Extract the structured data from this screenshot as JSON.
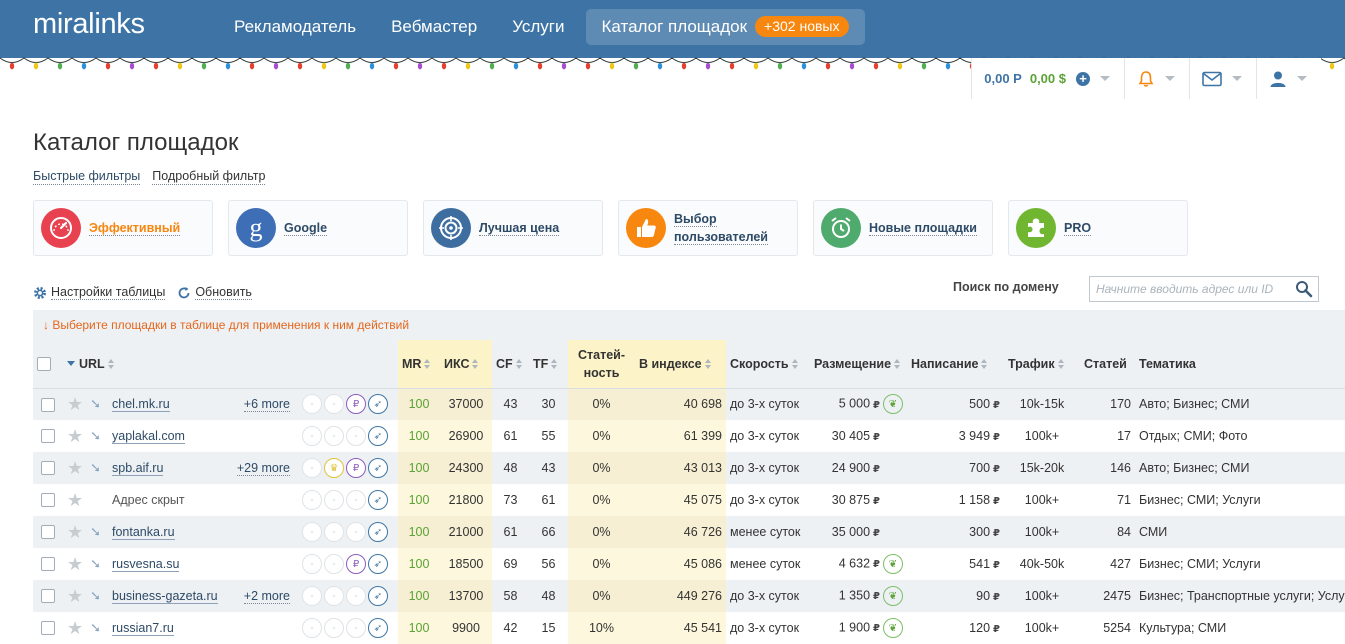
{
  "app": {
    "logo": "miralinks"
  },
  "nav": [
    {
      "label": "Рекламодатель"
    },
    {
      "label": "Вебмастер"
    },
    {
      "label": "Услуги"
    },
    {
      "label": "Каталог площадок",
      "badge": "+302 новых"
    }
  ],
  "userbar": {
    "balance_rub": "0,00 Р",
    "balance_usd": "0,00 $"
  },
  "page": {
    "title": "Каталог площадок"
  },
  "filter_tabs": [
    "Быстрые фильтры",
    "Подробный фильтр"
  ],
  "cards": [
    {
      "label": "Эффективный",
      "icon": "speedometer-icon",
      "color": "#e8414f"
    },
    {
      "label": "Google",
      "icon": "google-icon",
      "color": "#3e6eb5"
    },
    {
      "label": "Лучшая цена",
      "icon": "target-icon",
      "color": "#3e6ea0"
    },
    {
      "label1": "Выбор",
      "label2": "пользователей",
      "icon": "thumbs-up-icon",
      "color": "#f7870f"
    },
    {
      "label": "Новые площадки",
      "icon": "alarm-clock-icon",
      "color": "#4faa6e"
    },
    {
      "label": "PRO",
      "icon": "puzzle-icon",
      "color": "#70b630"
    }
  ],
  "tools": {
    "settings": "Настройки таблицы",
    "refresh": "Обновить"
  },
  "search": {
    "label": "Поиск по домену",
    "placeholder": "Начните вводить адрес или ID"
  },
  "notice": "↓ Выберите площадки в таблице для применения к ним действий",
  "columns": {
    "url": "URL",
    "mr": "MR",
    "iks": "ИКС",
    "cf": "CF",
    "tf": "TF",
    "articles_pct_1": "Статей-",
    "articles_pct_2": "ность",
    "indexed": "В индексе",
    "speed": "Скорость",
    "placement": "Размещение",
    "writing": "Написание",
    "traffic": "Трафик",
    "articles": "Статей",
    "topic": "Тематика"
  },
  "currency_sign": "₽",
  "rows": [
    {
      "url": "chel.mk.ru",
      "more": "+6 more",
      "mr": "100",
      "iks": "37000",
      "cf": "43",
      "tf": "30",
      "pct": "0%",
      "indexed": "40 698",
      "speed": "до 3-х суток",
      "placement": "5 000",
      "writing": "500",
      "traffic": "10k-15k",
      "articles": "170",
      "topic": "Авто; Бизнес; СМИ"
    },
    {
      "url": "yaplakal.com",
      "more": "",
      "mr": "100",
      "iks": "26900",
      "cf": "61",
      "tf": "55",
      "pct": "0%",
      "indexed": "61 399",
      "speed": "до 3-х суток",
      "placement": "30 405",
      "writing": "3 949",
      "traffic": "100k+",
      "articles": "17",
      "topic": "Отдых; СМИ; Фото"
    },
    {
      "url": "spb.aif.ru",
      "more": "+29 more",
      "mr": "100",
      "iks": "24300",
      "cf": "48",
      "tf": "43",
      "pct": "0%",
      "indexed": "43 013",
      "speed": "до 3-х суток",
      "placement": "24 900",
      "writing": "700",
      "traffic": "15k-20k",
      "articles": "146",
      "topic": "Авто; Бизнес; СМИ"
    },
    {
      "url": "Адрес скрыт",
      "more": "",
      "mr": "100",
      "iks": "21800",
      "cf": "73",
      "tf": "61",
      "pct": "0%",
      "indexed": "45 075",
      "speed": "до 3-х суток",
      "placement": "30 875",
      "writing": "1 158",
      "traffic": "100k+",
      "articles": "71",
      "topic": "Бизнес; СМИ; Услуги"
    },
    {
      "url": "fontanka.ru",
      "more": "",
      "mr": "100",
      "iks": "21000",
      "cf": "61",
      "tf": "66",
      "pct": "0%",
      "indexed": "46 726",
      "speed": "менее суток",
      "placement": "35 000",
      "writing": "300",
      "traffic": "100k+",
      "articles": "84",
      "topic": "СМИ"
    },
    {
      "url": "rusvesna.su",
      "more": "",
      "mr": "100",
      "iks": "18500",
      "cf": "69",
      "tf": "56",
      "pct": "0%",
      "indexed": "45 086",
      "speed": "менее суток",
      "placement": "4 632",
      "writing": "541",
      "traffic": "40k-50k",
      "articles": "427",
      "topic": "Бизнес; СМИ; Услуги"
    },
    {
      "url": "business-gazeta.ru",
      "more": "+2 more",
      "mr": "100",
      "iks": "13700",
      "cf": "58",
      "tf": "48",
      "pct": "0%",
      "indexed": "449 276",
      "speed": "до 3-х суток",
      "placement": "1 350",
      "writing": "90",
      "traffic": "100k+",
      "articles": "2475",
      "topic": "Бизнес; Транспортные услуги; Услуги"
    },
    {
      "url": "russian7.ru",
      "more": "",
      "mr": "100",
      "iks": "9900",
      "cf": "42",
      "tf": "15",
      "pct": "10%",
      "indexed": "45 541",
      "speed": "до 3-х суток",
      "placement": "1 900",
      "writing": "120",
      "traffic": "100k+",
      "articles": "5254",
      "topic": "Культура; СМИ"
    }
  ]
}
